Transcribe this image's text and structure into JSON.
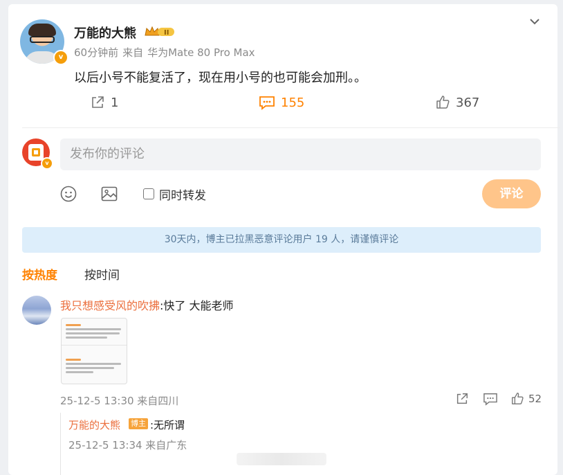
{
  "post": {
    "author": "万能的大熊",
    "level_badge": "II",
    "time": "60分钟前",
    "source_prefix": "来自",
    "source": "华为Mate 80 Pro Max",
    "content": "以后小号不能复活了，现在用小号的也可能会加刑。。",
    "actions": {
      "repost_count": "1",
      "comment_count": "155",
      "like_count": "367"
    }
  },
  "composer": {
    "placeholder": "发布你的评论",
    "repost_label": "同时转发",
    "submit_label": "评论"
  },
  "notice": "30天内，博主已拉黑恶意评论用户 19 人，请谨慎评论",
  "tabs": [
    {
      "label": "按热度",
      "active": true
    },
    {
      "label": "按时间",
      "active": false
    }
  ],
  "comments": [
    {
      "user": "我只想感受风的吹拂",
      "text": ":快了 大能老师",
      "meta": "25-12-5 13:30 来自四川",
      "like_count": "52",
      "reply": {
        "user": "万能的大熊",
        "badge": "博主",
        "text": ":无所谓",
        "meta": "25-12-5 13:34 来自广东"
      }
    }
  ],
  "colors": {
    "accent": "#ff8200",
    "name": "#eb6e3c",
    "notice_bg": "#ddeefb",
    "submit_bg": "#ffc58a"
  }
}
